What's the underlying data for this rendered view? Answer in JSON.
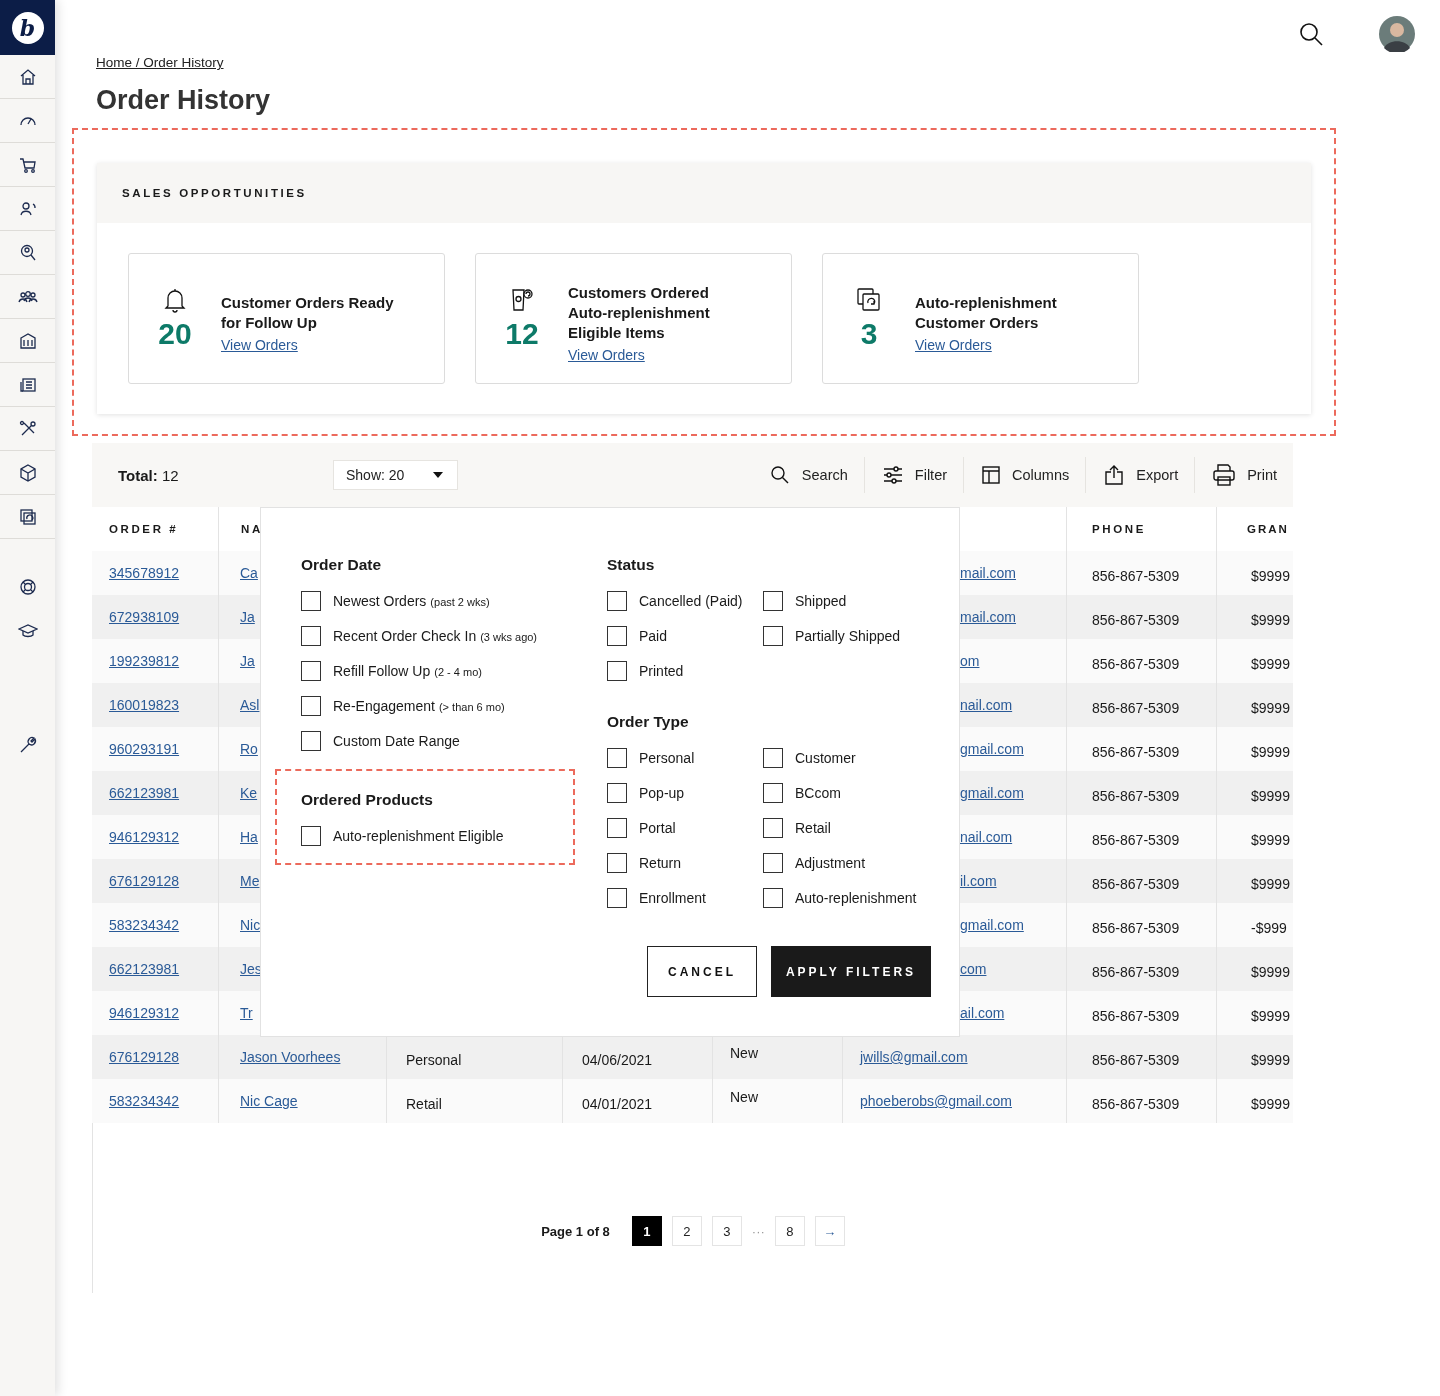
{
  "brand": {
    "logo_letter": "b"
  },
  "breadcrumb": "Home / Order History",
  "page_title": "Order History",
  "sales_opportunities": {
    "title": "SALES OPPORTUNITIES",
    "highlighted": true,
    "cards": [
      {
        "kind": "bell",
        "count": "20",
        "title": "Customer Orders Ready for Follow Up",
        "link": "View Orders"
      },
      {
        "kind": "product",
        "count": "12",
        "title": "Customers Ordered Auto-replenishment Eligible Items",
        "link": "View Orders"
      },
      {
        "kind": "replenish",
        "count": "3",
        "title": "Auto-replenishment Customer Orders",
        "link": "View Orders"
      }
    ]
  },
  "toolbar": {
    "total_label": "Total:",
    "total": "12",
    "show": "Show: 20",
    "actions": [
      {
        "kind": "search",
        "label": "Search"
      },
      {
        "kind": "filter",
        "label": "Filter"
      },
      {
        "kind": "columns",
        "label": "Columns"
      },
      {
        "kind": "export",
        "label": "Export"
      },
      {
        "kind": "print",
        "label": "Print"
      }
    ]
  },
  "table": {
    "columns": {
      "order": "ORDER #",
      "name": "NA",
      "phone": "PHONE",
      "grand_total": "GRAN"
    },
    "rows": [
      {
        "order": "345678912",
        "name": "Ca",
        "email": "mail.com",
        "phone": "856-867-5309",
        "total": "$9999"
      },
      {
        "order": "672938109",
        "name": "Ja",
        "email": "mail.com",
        "phone": "856-867-5309",
        "total": "$9999"
      },
      {
        "order": "199239812",
        "name": "Ja",
        "email": "om",
        "phone": "856-867-5309",
        "total": "$9999"
      },
      {
        "order": "160019823",
        "name": "Asl",
        "email": "nail.com",
        "phone": "856-867-5309",
        "total": "$9999"
      },
      {
        "order": "960293191",
        "name": "Ro",
        "email": "gmail.com",
        "phone": "856-867-5309",
        "total": "$9999"
      },
      {
        "order": "662123981",
        "name": "Ke",
        "email": "gmail.com",
        "phone": "856-867-5309",
        "total": "$9999"
      },
      {
        "order": "946129312",
        "name": "Ha",
        "email": "nail.com",
        "phone": "856-867-5309",
        "total": "$9999"
      },
      {
        "order": "676129128",
        "name": "Me",
        "email": "il.com",
        "phone": "856-867-5309",
        "total": "$9999"
      },
      {
        "order": "583234342",
        "name": "Nic",
        "email": "gmail.com",
        "phone": "856-867-5309",
        "total": "-$999"
      },
      {
        "order": "662123981",
        "name": "Jes",
        "email": "com",
        "phone": "856-867-5309",
        "total": "$9999"
      },
      {
        "order": "946129312",
        "name": "Tr",
        "email": "ail.com",
        "phone": "856-867-5309",
        "total": "$9999"
      },
      {
        "order": "676129128",
        "name": "Jason Voorhees",
        "type": "Personal",
        "date": "04/06/2021",
        "status": "New",
        "email": "jwills@gmail.com",
        "phone": "856-867-5309",
        "total": "$9999"
      },
      {
        "order": "583234342",
        "name": "Nic Cage",
        "type": "Retail",
        "date": "04/01/2021",
        "status": "New",
        "email": "phoeberobs@gmail.com",
        "phone": "856-867-5309",
        "total": "$9999"
      }
    ]
  },
  "filter_panel": {
    "order_date": {
      "title": "Order Date",
      "options": [
        {
          "label": "Newest Orders",
          "note": "(past 2 wks)",
          "checked": false
        },
        {
          "label": "Recent Order Check In",
          "note": "(3 wks ago)",
          "checked": false
        },
        {
          "label": "Refill Follow Up",
          "note": "(2 - 4 mo)",
          "checked": false
        },
        {
          "label": "Re-Engagement",
          "note": "(> than 6 mo)",
          "checked": false
        },
        {
          "label": "Custom Date Range",
          "checked": false
        }
      ]
    },
    "ordered_products": {
      "title": "Ordered Products",
      "highlighted": true,
      "options": [
        {
          "label": "Auto-replenishment Eligible",
          "checked": false
        }
      ]
    },
    "status": {
      "title": "Status",
      "options": [
        {
          "label": "Cancelled (Paid)",
          "checked": false
        },
        {
          "label": "Shipped",
          "checked": false
        },
        {
          "label": "Paid",
          "checked": false
        },
        {
          "label": "Partially Shipped",
          "checked": false
        },
        {
          "label": "Printed",
          "checked": false
        }
      ]
    },
    "order_type": {
      "title": "Order Type",
      "options": [
        {
          "label": "Personal",
          "checked": false
        },
        {
          "label": "Customer",
          "checked": false
        },
        {
          "label": "Pop-up",
          "checked": false
        },
        {
          "label": "BCcom",
          "checked": false
        },
        {
          "label": "Portal",
          "checked": false
        },
        {
          "label": "Retail",
          "checked": false
        },
        {
          "label": "Return",
          "checked": false
        },
        {
          "label": "Adjustment",
          "checked": false
        },
        {
          "label": "Enrollment",
          "checked": false
        },
        {
          "label": "Auto-replenishment",
          "checked": false
        }
      ]
    },
    "buttons": [
      {
        "kind": "secondary",
        "label": "CANCEL"
      },
      {
        "kind": "primary",
        "label": "APPLY FILTERS"
      }
    ]
  },
  "pagination": {
    "label": "Page 1 of 8",
    "pages": [
      {
        "label": "1",
        "selected": true
      },
      {
        "label": "2",
        "selected": false
      },
      {
        "label": "3",
        "selected": false
      },
      {
        "kind": "gap",
        "label": "···"
      },
      {
        "label": "8",
        "selected": false
      }
    ],
    "next": "→"
  }
}
